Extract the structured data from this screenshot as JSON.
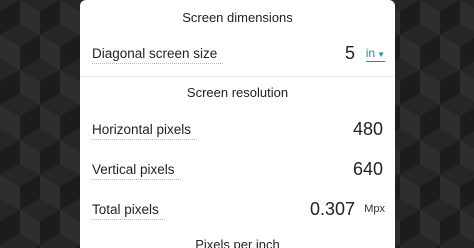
{
  "sections": {
    "dimensions_title": "Screen dimensions",
    "resolution_title": "Screen resolution",
    "ppi_title": "Pixels per inch"
  },
  "fields": {
    "diagonal": {
      "label": "Diagonal screen size",
      "value": "5",
      "unit": "in"
    },
    "horizontal": {
      "label": "Horizontal pixels",
      "value": "480"
    },
    "vertical": {
      "label": "Vertical pixels",
      "value": "640"
    },
    "total": {
      "label": "Total pixels",
      "value": "0.307",
      "unit": "Mpx"
    }
  },
  "colors": {
    "accent": "#1a8fc0",
    "card": "#ffffff",
    "background": "#1c1c1c"
  }
}
